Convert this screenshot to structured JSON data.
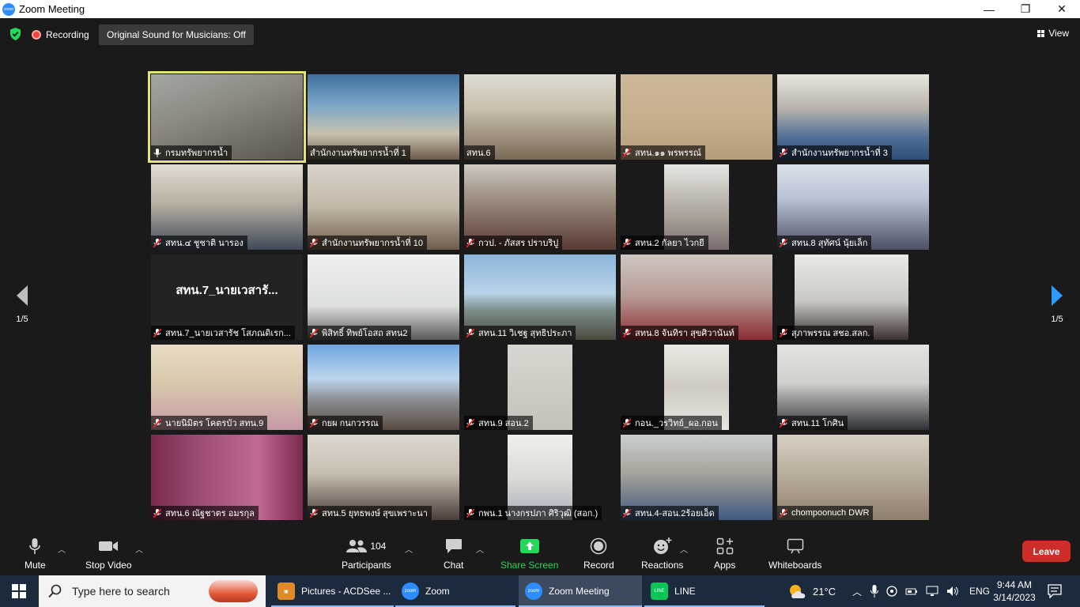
{
  "window": {
    "title": "Zoom Meeting",
    "app_icon": "zoom-logo-icon",
    "minimize": "—",
    "maximize": "❐",
    "close": "✕"
  },
  "topbar": {
    "recording": "Recording",
    "original_sound": "Original Sound for Musicians: Off",
    "view": "View"
  },
  "colors": {
    "active_speaker": "#e4e27a",
    "share_screen": "#23d959",
    "leave": "#cf2d2a",
    "recording": "#f2453d",
    "muted": "#e02828"
  },
  "participants": [
    {
      "name": "กรมทรัพยากรน้ำ",
      "muted": false,
      "active": true
    },
    {
      "name": "สำนักงานทรัพยากรน้ำที่ 1",
      "muted": false
    },
    {
      "name": "สทน.6",
      "muted": false
    },
    {
      "name": "สทน.๑๑ พรพรรณ์",
      "muted": true
    },
    {
      "name": "สำนักงานทรัพยากรน้ำที่ 3",
      "muted": true
    },
    {
      "name": "สทน.๔ ชูชาติ นารอง",
      "muted": true
    },
    {
      "name": "สำนักงานทรัพยากรน้ำที่ 10",
      "muted": true
    },
    {
      "name": "กวป. - ภัสสร ปราบริปู",
      "muted": true
    },
    {
      "name": "สทน.2 กัลยา ไวกยี",
      "muted": true
    },
    {
      "name": "สทน.8 สุทัศน์ นุ้ยเล็ก",
      "muted": true
    },
    {
      "name": "สทน.7_นายเวสารัช โสภณดิเรก...",
      "muted": true,
      "video_off_label": "สทน.7_นายเวสารั..."
    },
    {
      "name": "พิสิทธิ์ ทิพย์โอสถ สทน2",
      "muted": true
    },
    {
      "name": "สทน.11 วิเชฐ สุทธิประภา",
      "muted": true
    },
    {
      "name": "สทน.8 จันทิรา สุขศิวานันท์",
      "muted": true
    },
    {
      "name": "สุภาพรรณ สชอ.สลก.",
      "muted": true
    },
    {
      "name": "นายนิมิตร โคตรบัว สทน.9",
      "muted": true
    },
    {
      "name": "กยผ กนกวรรณ",
      "muted": true
    },
    {
      "name": "สทน.9 สอน.2",
      "muted": true
    },
    {
      "name": "กอน._วรวิทย์_ผอ.กอน",
      "muted": true
    },
    {
      "name": "สทน.11 โกศิน",
      "muted": true
    },
    {
      "name": "สทน.6 ณัฐชาตร อมรกุล",
      "muted": true
    },
    {
      "name": "สทน.5 ยุทธพงษ์ สุขเพราะนา",
      "muted": true
    },
    {
      "name": "กพน.1 นางกรปภา ศิริวุฒิ (สอก.)",
      "muted": true
    },
    {
      "name": "สทน.4-สอน.2ร้อยเอ็ด",
      "muted": true
    },
    {
      "name": "chompoonuch DWR",
      "muted": true
    }
  ],
  "pagination": {
    "left": "1/5",
    "right": "1/5"
  },
  "toolbar": {
    "mute": "Mute",
    "stop_video": "Stop Video",
    "participants": "Participants",
    "participants_count": "104",
    "chat": "Chat",
    "share_screen": "Share Screen",
    "record": "Record",
    "reactions": "Reactions",
    "apps": "Apps",
    "whiteboards": "Whiteboards",
    "leave": "Leave"
  },
  "taskbar": {
    "search_placeholder": "Type here to search",
    "apps": [
      {
        "label": "Pictures - ACDSee ...",
        "icon": "acdsee-icon"
      },
      {
        "label": "Zoom",
        "icon": "zoom-icon"
      },
      {
        "label": "Zoom Meeting",
        "icon": "zoom-icon",
        "active": true
      },
      {
        "label": "LINE",
        "icon": "line-icon"
      }
    ],
    "weather": "21°C",
    "language": "ENG",
    "time": "9:44 AM",
    "date": "3/14/2023"
  }
}
